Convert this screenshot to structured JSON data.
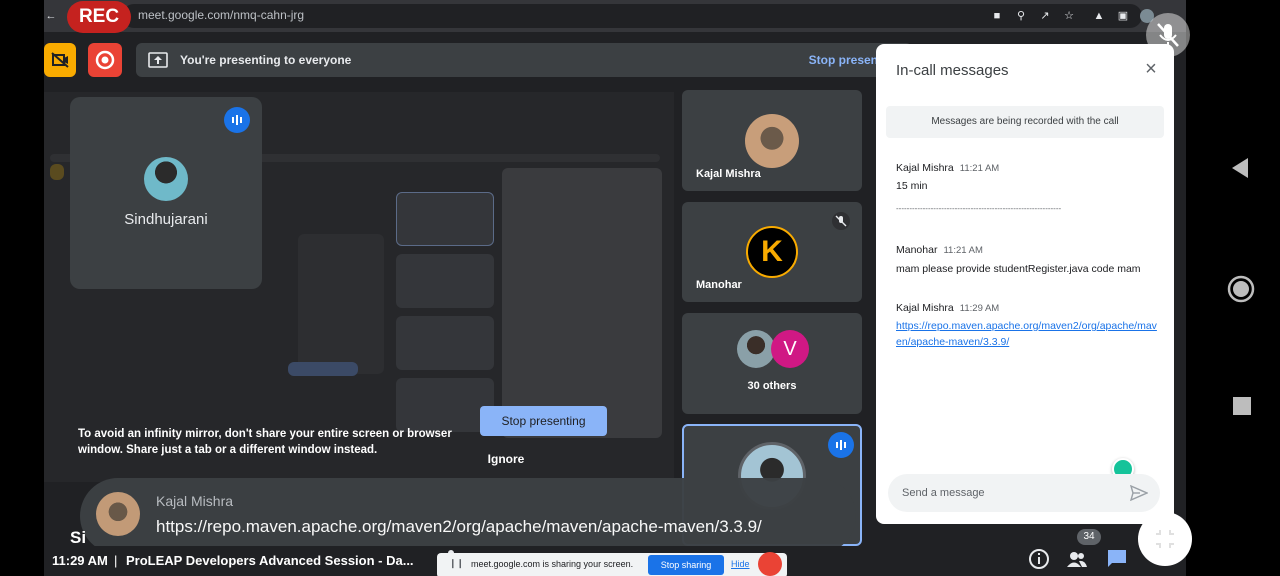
{
  "browser": {
    "url": "meet.google.com/nmq-cahn-jrg",
    "rec_label": "REC"
  },
  "meet": {
    "presenting_text": "You're presenting to everyone",
    "stop_presenting_top": "Stop presenting",
    "self_name": "Sindhujarani",
    "tiles": [
      {
        "name": "Kajal Mishra"
      },
      {
        "name": "Manohar",
        "avatar_letter": "K"
      },
      {
        "name": "30 others",
        "avatar_letter": "V"
      }
    ],
    "mirror_warning": "To avoid an infinity mirror, don't share your entire screen or browser window. Share just a tab or a different window instead.",
    "stop_presenting_button": "Stop presenting",
    "ignore_button": "Ignore"
  },
  "caption": {
    "name": "Kajal Mishra",
    "text": "https://repo.maven.apache.org/maven2/org/apache/maven/apache-maven/3.3.9/",
    "speaker_tag": "Si"
  },
  "bottom_bar": {
    "time": "11:29 AM",
    "separator": "|",
    "meeting_title": "ProLEAP Developers Advanced Session - Da...",
    "share_text": "meet.google.com is sharing your screen.",
    "stop_sharing": "Stop sharing",
    "hide": "Hide",
    "participants_count": "34"
  },
  "chat": {
    "title": "In-call messages",
    "recording_notice": "Messages are being recorded with the call",
    "messages": [
      {
        "sender": "Kajal Mishra",
        "time": "11:21 AM",
        "text": "15 min",
        "text2": "--------------------------------------------------------------"
      },
      {
        "sender": "Manohar",
        "time": "11:21 AM",
        "text": "mam please provide studentRegister.java code mam"
      },
      {
        "sender": "Kajal Mishra",
        "time": "11:29 AM",
        "link": "https://repo.maven.apache.org/maven2/org/apache/maven/apache-maven/3.3.9/"
      }
    ],
    "input_placeholder": "Send a message"
  },
  "colors": {
    "meet_bg": "#202124",
    "tile_bg": "#3c4043",
    "accent_blue": "#8ab4f8",
    "rec_red": "#c5221f",
    "link_blue": "#1a73e8"
  }
}
